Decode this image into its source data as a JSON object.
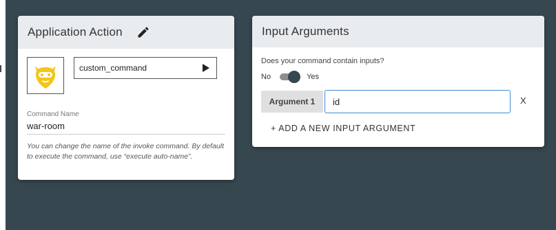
{
  "application_action": {
    "title": "Application Action",
    "command": "custom_command",
    "command_name_label": "Command Name",
    "command_name_value": "war-room",
    "help_text": "You can change the name of the invoke command. By default to execute the command, use “execute auto-name”."
  },
  "input_arguments": {
    "title": "Input Arguments",
    "question": "Does your command contain inputs?",
    "toggle_off_label": "No",
    "toggle_on_label": "Yes",
    "toggle_on": true,
    "arguments": [
      {
        "label": "Argument 1",
        "value": "id",
        "remove_label": "X"
      }
    ],
    "add_label": "+ ADD A NEW INPUT ARGUMENT"
  },
  "colors": {
    "background": "#37474f",
    "card": "#ffffff",
    "card_header": "#e9ecef",
    "logo_yellow": "#f5c518",
    "input_focus_border": "#3d8bd0"
  },
  "icons": [
    "pencil-icon",
    "play-icon",
    "robot-logo-icon"
  ]
}
